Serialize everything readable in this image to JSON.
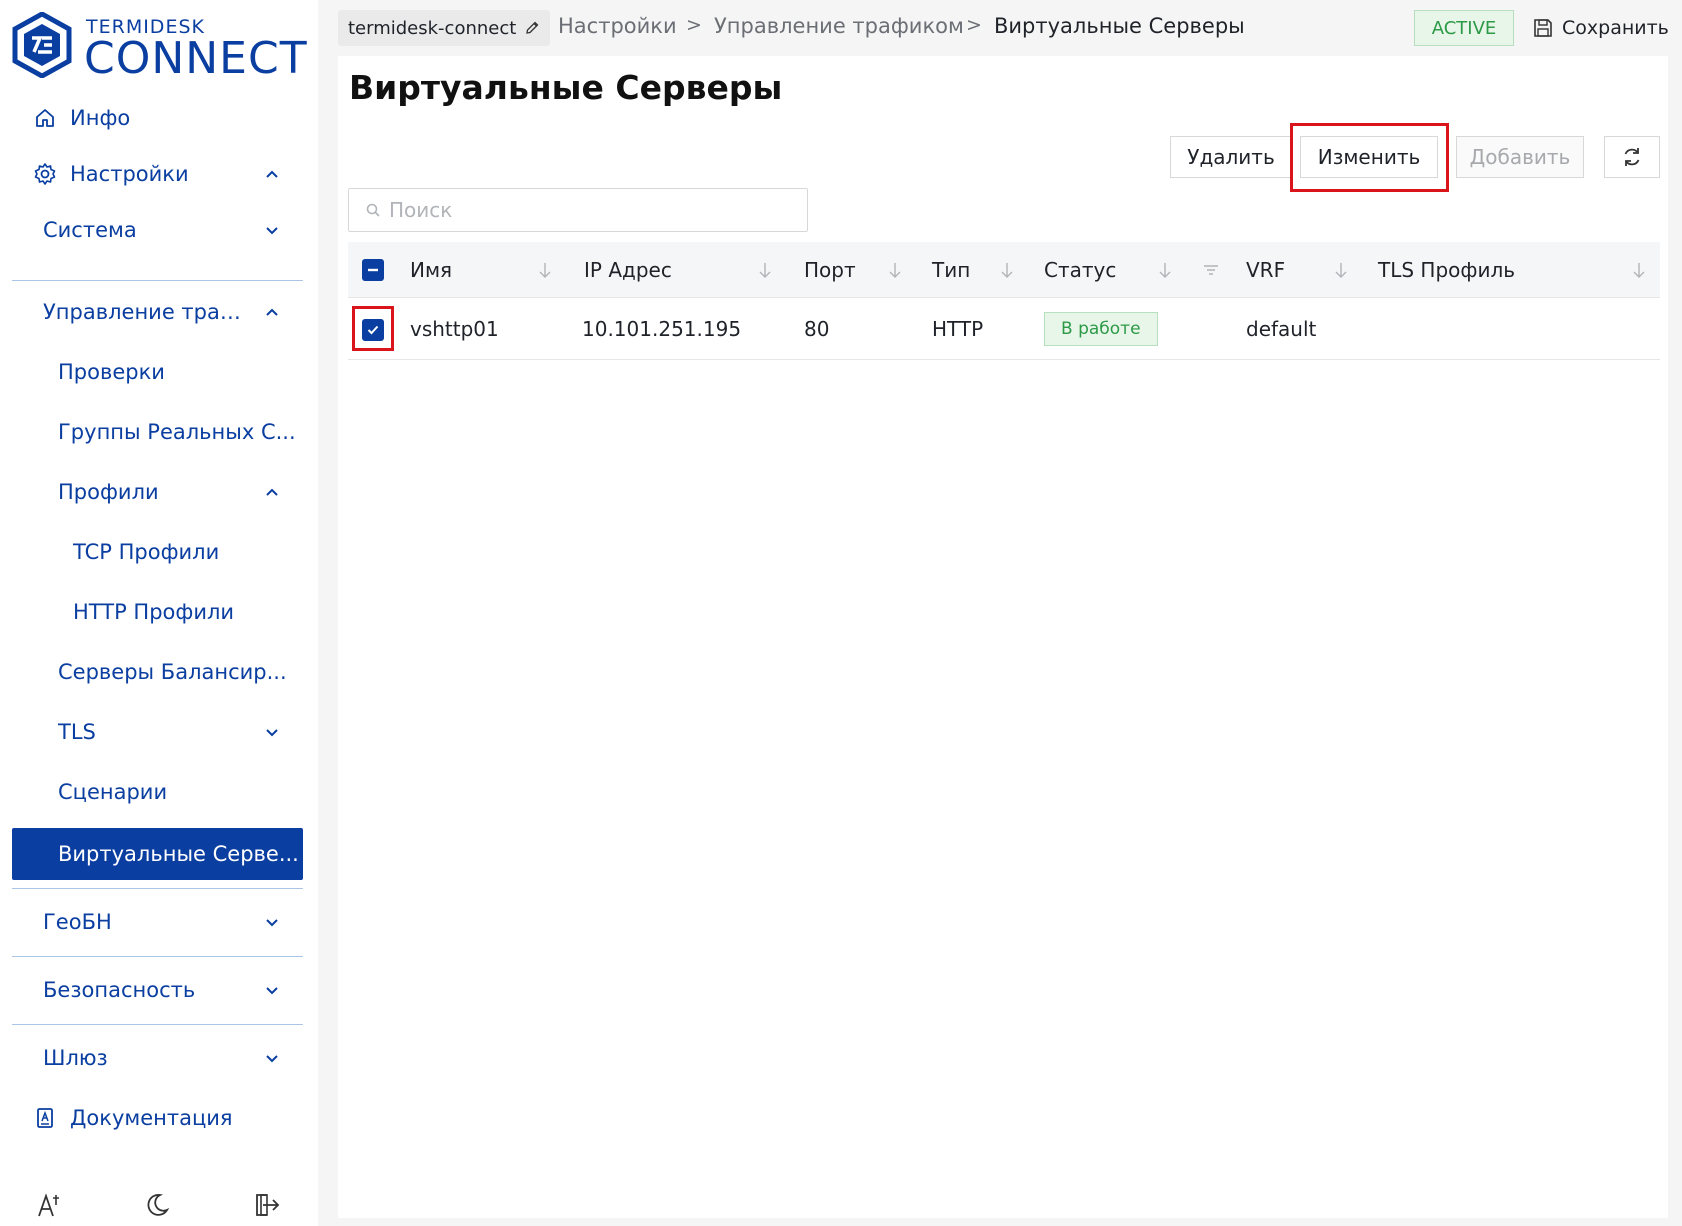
{
  "logo": {
    "small": "TERMIDESK",
    "big": "CONNECT"
  },
  "sidebar": {
    "items": [
      {
        "label": "Инфо",
        "icon": "home-icon"
      },
      {
        "label": "Настройки",
        "icon": "gear-icon"
      },
      {
        "label": "Система"
      },
      {
        "label": "Управление трафи..."
      },
      {
        "label": "Проверки"
      },
      {
        "label": "Группы Реальных С..."
      },
      {
        "label": "Профили"
      },
      {
        "label": "TCP Профили"
      },
      {
        "label": "HTTP Профили"
      },
      {
        "label": "Серверы Балансир..."
      },
      {
        "label": "TLS"
      },
      {
        "label": "Сценарии"
      },
      {
        "label": "Виртуальные Серве..."
      },
      {
        "label": "ГеоБН"
      },
      {
        "label": "Безопасность"
      },
      {
        "label": "Шлюз"
      },
      {
        "label": "Документация",
        "icon": "document-icon"
      }
    ],
    "footer_icons": [
      "font-size-icon",
      "moon-icon",
      "logout-icon"
    ]
  },
  "header": {
    "device": "termidesk-connect",
    "breadcrumbs": [
      "Настройки",
      "Управление трафиком",
      "Виртуальные Серверы"
    ],
    "separator": ">",
    "status": "ACTIVE",
    "save_label": "Сохранить"
  },
  "main": {
    "title": "Виртуальные Серверы",
    "buttons": {
      "delete": "Удалить",
      "edit": "Изменить",
      "add": "Добавить"
    },
    "search_placeholder": "Поиск",
    "columns": [
      "Имя",
      "IP Адрес",
      "Порт",
      "Тип",
      "Статус",
      "VRF",
      "TLS Профиль"
    ],
    "rows": [
      {
        "name": "vshttp01",
        "ip": "10.101.251.195",
        "port": "80",
        "type": "HTTP",
        "status": "В работе",
        "vrf": "default",
        "tls": ""
      }
    ]
  },
  "colors": {
    "brand": "#0a3ea1",
    "success": "#2c9a46",
    "highlight": "#d9141b"
  }
}
